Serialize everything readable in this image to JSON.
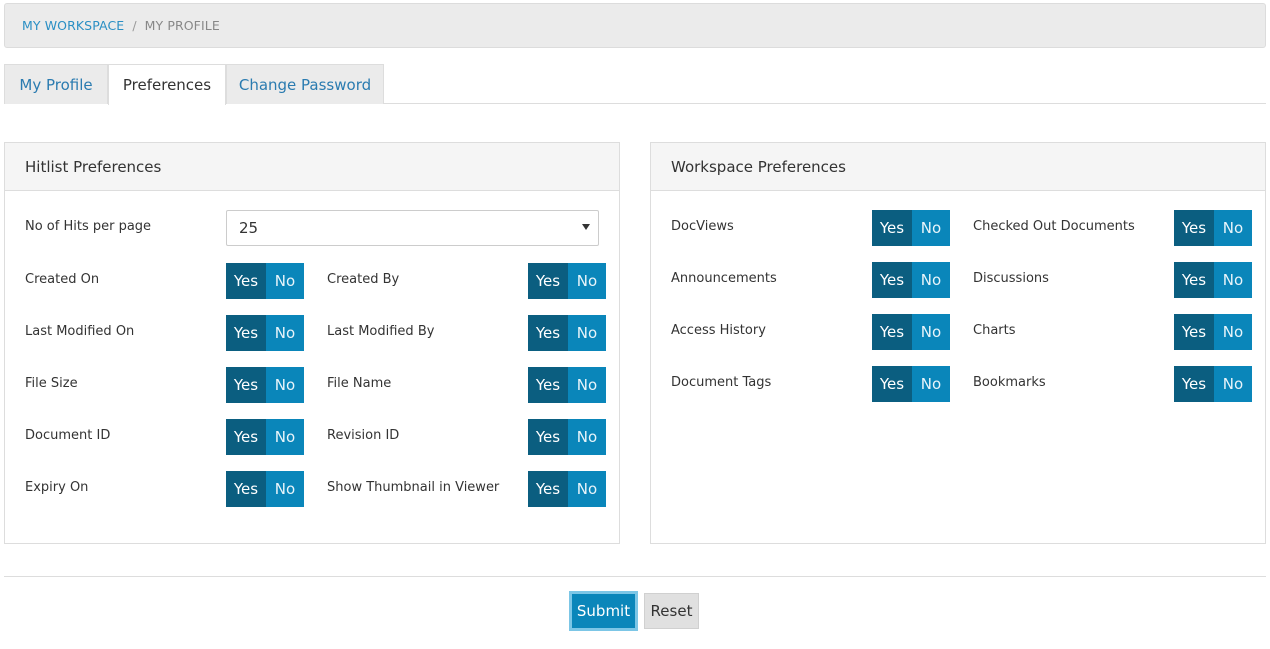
{
  "breadcrumb": {
    "workspace": "MY WORKSPACE",
    "separator": "/",
    "current": "MY PROFILE"
  },
  "tabs": [
    {
      "label": "My Profile",
      "active": false
    },
    {
      "label": "Preferences",
      "active": true
    },
    {
      "label": "Change Password",
      "active": false
    }
  ],
  "hitlist": {
    "title": "Hitlist Preferences",
    "hits_label": "No of Hits per page",
    "hits_value": "25",
    "toggle_yes": "Yes",
    "toggle_no": "No",
    "items": [
      "Created On",
      "Created By",
      "Last Modified On",
      "Last Modified By",
      "File Size",
      "File Name",
      "Document ID",
      "Revision ID",
      "Expiry On",
      "Show Thumbnail in Viewer"
    ]
  },
  "workspace": {
    "title": "Workspace Preferences",
    "items": [
      "DocViews",
      "Checked Out Documents",
      "Announcements",
      "Discussions",
      "Access History",
      "Charts",
      "Document Tags",
      "Bookmarks"
    ]
  },
  "actions": {
    "submit": "Submit",
    "reset": "Reset"
  },
  "colors": {
    "yes_bg": "#0b5e80",
    "no_bg": "#0a86ba",
    "link": "#2a8fc4"
  }
}
